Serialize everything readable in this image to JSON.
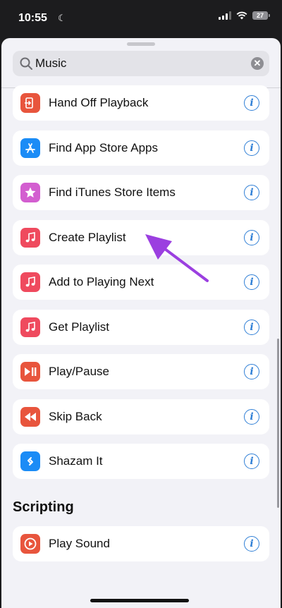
{
  "status": {
    "time": "10:55",
    "battery": "27"
  },
  "search": {
    "query": "Music",
    "clear": "✕"
  },
  "actions": [
    {
      "label": "Hand Off Playback",
      "icon": "handoff-icon",
      "color": "#e8553d"
    },
    {
      "label": "Find App Store Apps",
      "icon": "app-store-icon",
      "color": "#1b8cf6"
    },
    {
      "label": "Find iTunes Store Items",
      "icon": "star-icon",
      "color": "#d35ed0"
    },
    {
      "label": "Create Playlist",
      "icon": "music-note-icon",
      "color": "#ef4a5e"
    },
    {
      "label": "Add to Playing Next",
      "icon": "music-note-icon",
      "color": "#ef4a5e"
    },
    {
      "label": "Get Playlist",
      "icon": "music-note-icon",
      "color": "#ef4a5e"
    },
    {
      "label": "Play/Pause",
      "icon": "play-pause-icon",
      "color": "#e8553d"
    },
    {
      "label": "Skip Back",
      "icon": "skip-back-icon",
      "color": "#e8553d"
    },
    {
      "label": "Shazam It",
      "icon": "shazam-icon",
      "color": "#1b8cf6"
    }
  ],
  "scripting": {
    "title": "Scripting",
    "actions": [
      {
        "label": "Play Sound",
        "icon": "play-sound-icon",
        "color": "#e8553d"
      }
    ]
  },
  "annotation_color": "#9b3fe0"
}
